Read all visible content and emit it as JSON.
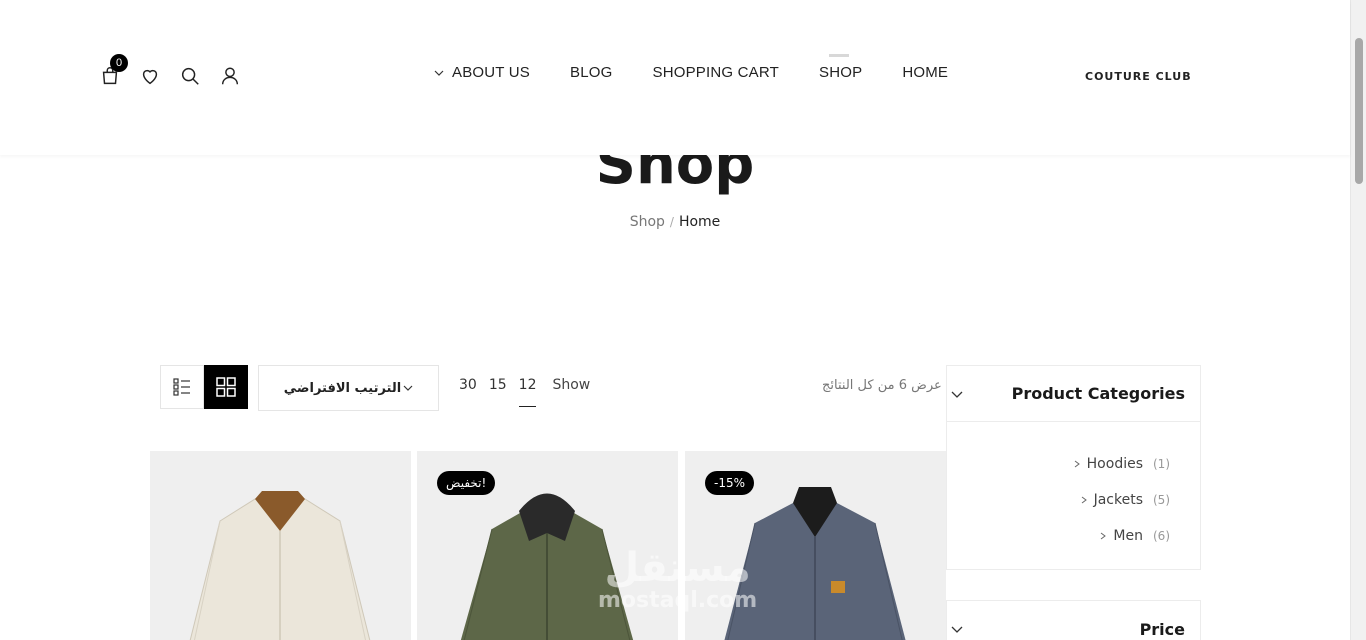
{
  "header": {
    "cart_count": "0",
    "nav": [
      {
        "label": "ABOUT US"
      },
      {
        "label": "BLOG"
      },
      {
        "label": "SHOPPING CART"
      },
      {
        "label": "SHOP"
      },
      {
        "label": "HOME"
      }
    ],
    "logo_text": "COUTURE CLUB"
  },
  "page": {
    "title": "Shop",
    "breadcrumb": {
      "current": "Shop",
      "separator": "/",
      "home": "Home"
    }
  },
  "toolbar": {
    "sort_value": "الترتيب الافتراضي",
    "counts": [
      "30",
      "15",
      "12"
    ],
    "active_count": "12",
    "show_label": "Show",
    "results_text": "عرض 6 من كل النتائج"
  },
  "sidebar": {
    "categories_title": "Product Categories",
    "categories": [
      {
        "name": "Hoodies",
        "count": "(1)"
      },
      {
        "name": "Jackets",
        "count": "(5)"
      },
      {
        "name": "Men",
        "count": "(6)"
      }
    ],
    "price_title": "Price"
  },
  "products": [
    {
      "badge": "",
      "color": "#e9e4d8",
      "collar": "#8a5a2b"
    },
    {
      "badge": "تخفيض!",
      "color": "#5d6748",
      "collar": "#2a2a2a"
    },
    {
      "badge": "-15%",
      "color": "#5a6478",
      "collar": "#1c1c1c"
    }
  ],
  "watermark": {
    "arabic": "مستقل",
    "latin": "mostaql.com"
  },
  "icons": {
    "cart": "shopping-bag-icon",
    "wishlist": "heart-icon",
    "search": "search-icon",
    "account": "user-icon",
    "list_view": "list-view-icon",
    "grid_view": "grid-view-icon"
  }
}
